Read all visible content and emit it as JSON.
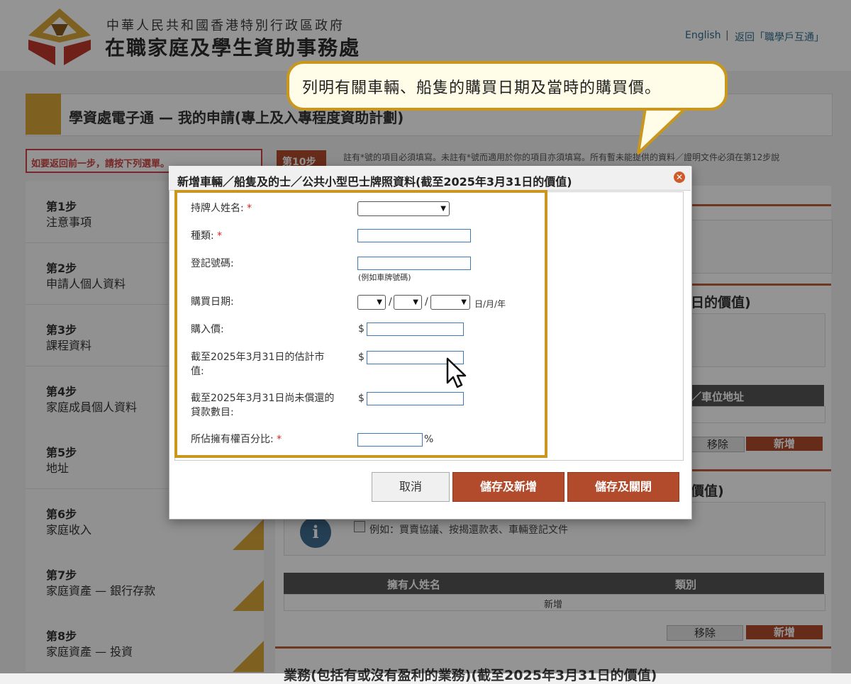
{
  "header": {
    "org_line1": "中華人民共和國香港特別行政區政府",
    "org_line2": "在職家庭及學生資助事務處",
    "lang_link": "English",
    "separator": "|",
    "back_link": "返回「職學戶互通」"
  },
  "page_title": "學資處電子通 — 我的申請(專上及入專程度資助計劃)",
  "sidebar": {
    "back_label": "如要返回前一步，請按下列選單。",
    "steps": [
      {
        "num": "第1步",
        "name": "注意事項"
      },
      {
        "num": "第2步",
        "name": "申請人個人資料"
      },
      {
        "num": "第3步",
        "name": "課程資料"
      },
      {
        "num": "第4步",
        "name": "家庭成員個人資料"
      },
      {
        "num": "第5步",
        "name": "地址"
      },
      {
        "num": "第6步",
        "name": "家庭收入"
      },
      {
        "num": "第7步",
        "name": "家庭資產 — 銀行存款"
      },
      {
        "num": "第8步",
        "name": "家庭資產 — 投資"
      }
    ]
  },
  "main": {
    "step_tag": "第10步",
    "note": "註有*號的項目必須填寫。未註有*號而適用於你的項目亦須填寫。所有暫未能提供的資料／證明文件必須在第12步說",
    "section_value_title": "日的價值)",
    "address_col": "／車位地址",
    "remove_label": "移除",
    "add_label": "新增",
    "section2_title": "價值)",
    "example_text": "例如：買賣協議、按揭還款表、車輛登記文件",
    "table_headers": [
      "擁有人姓名",
      "類別"
    ],
    "table_empty": "新增",
    "remove_label2": "移除",
    "add_label2": "新增",
    "bottom_title": "業務(包括有或沒有盈利的業務)(截至2025年3月31日的價值)"
  },
  "dialog": {
    "title": "新增車輛／船隻及的士／公共小型巴士牌照資料(截至2025年3月31日的價值)",
    "close_icon": "close-icon",
    "fields": {
      "holder_label": "持牌人姓名:",
      "type_label": "種類:",
      "reg_label": "登記號碼:",
      "reg_hint": "(例如車牌號碼)",
      "date_label": "購買日期:",
      "date_suffix": "日/月/年",
      "date_sep": "/",
      "price_label": "購入價:",
      "market_label_1": "截至2025年3月31日的估計市",
      "market_label_2": "值:",
      "loan_label_1": "截至2025年3月31日尚未償還的",
      "loan_label_2": "貸款數目:",
      "share_label": "所佔擁有權百分比:",
      "currency": "$",
      "percent": "%",
      "required_mark": "*"
    },
    "buttons": {
      "cancel": "取消",
      "save_new": "儲存及新增",
      "save_close": "儲存及關閉"
    }
  },
  "callout": {
    "text": "列明有關車輛、船隻的購買日期及當時的購買價。"
  },
  "colors": {
    "accent_gold": "#c9971d",
    "brand_red": "#b24a2c",
    "link_blue": "#2f6f8f"
  }
}
